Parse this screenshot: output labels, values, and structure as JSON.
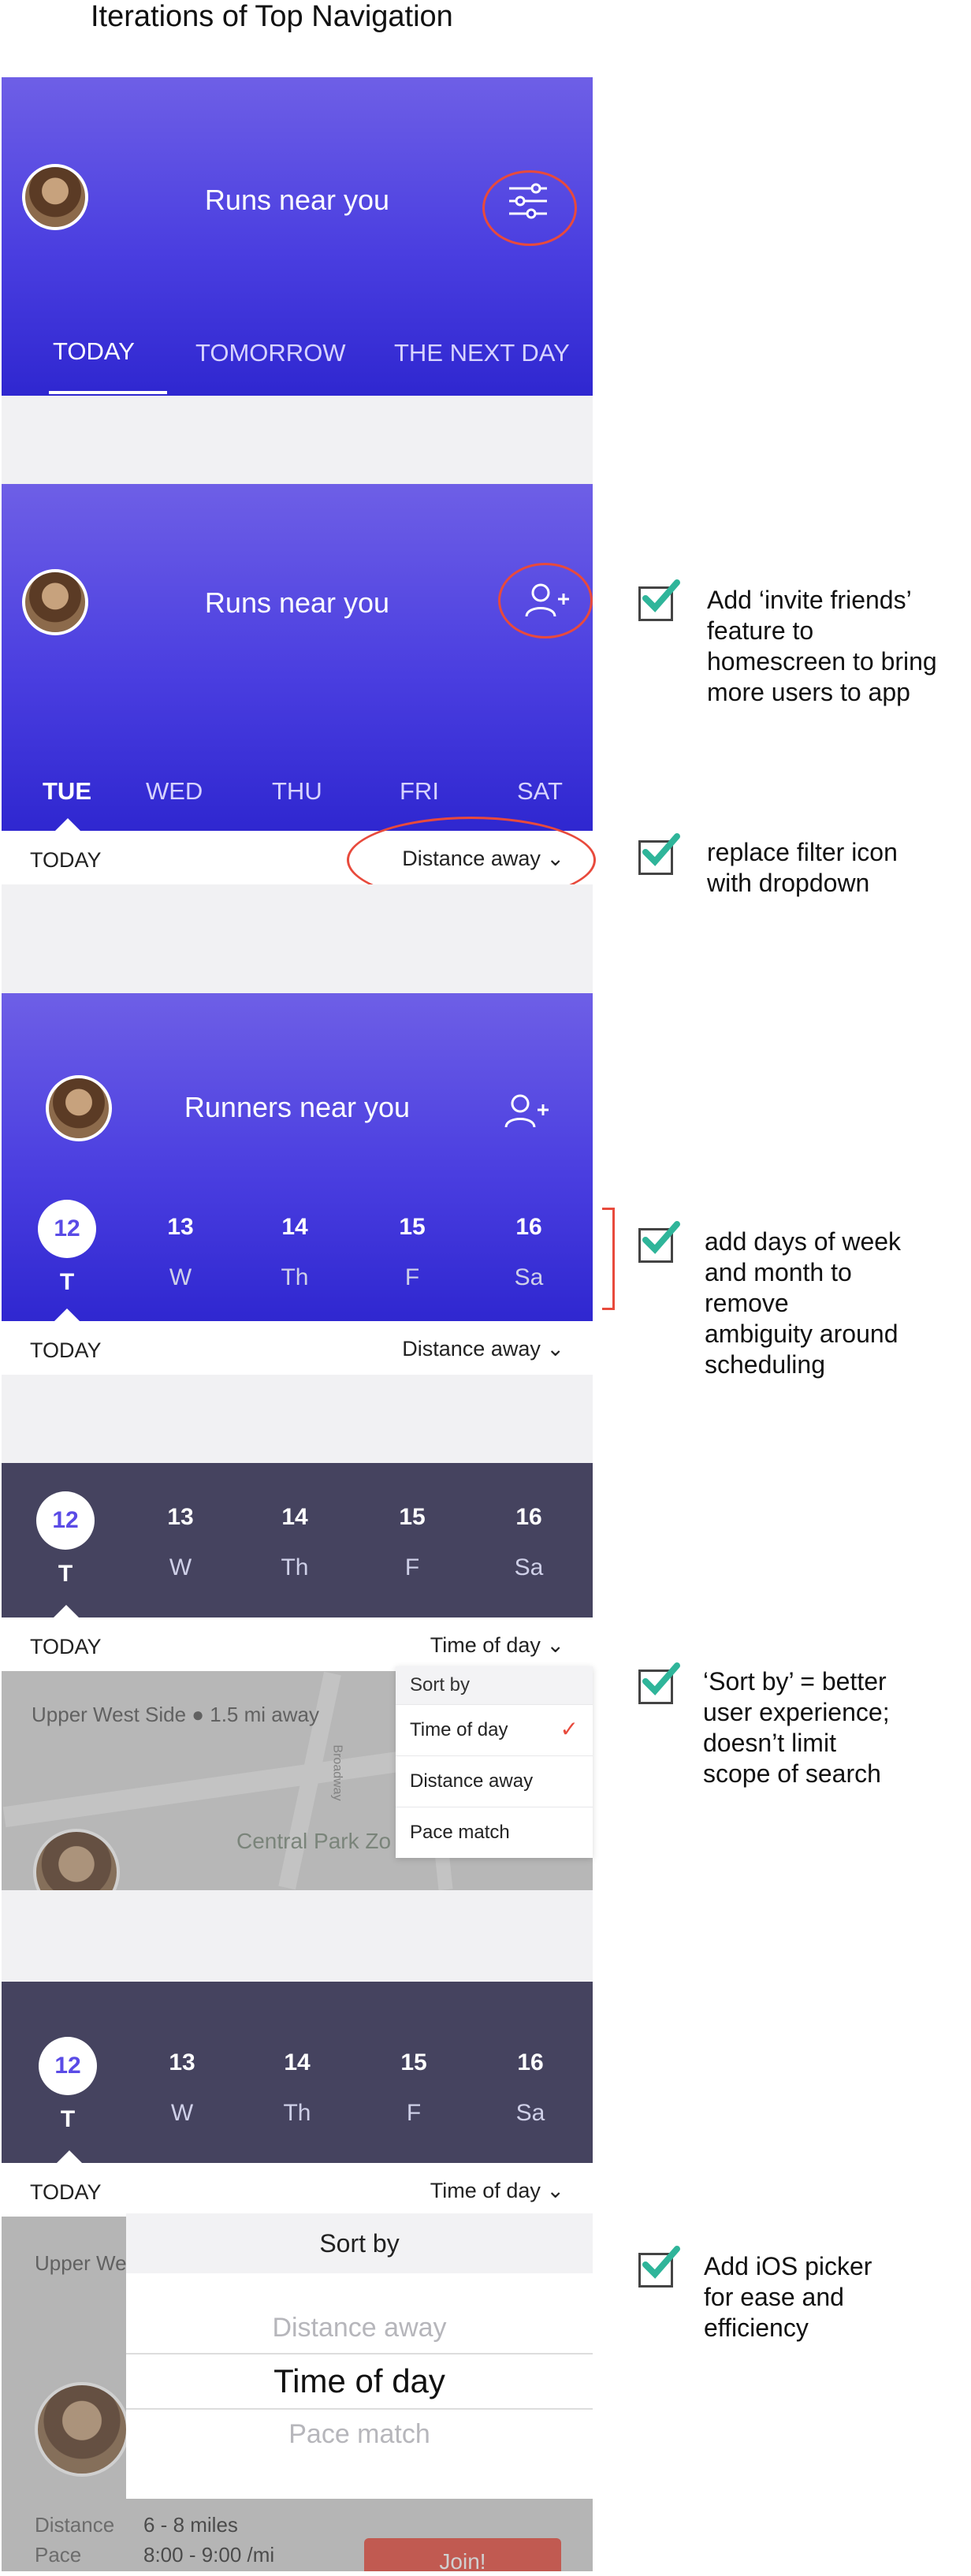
{
  "page_title": "Iterations of Top Navigation",
  "colors": {
    "brand": "#4a3ee0",
    "dark_header": "#45435f",
    "check": "#2fb59a",
    "annotation": "#e84a3c"
  },
  "screen1": {
    "title": "Runs near you",
    "tabs": [
      "TODAY",
      "TOMORROW",
      "THE NEXT DAY"
    ],
    "action_icon": "filter-sliders-icon"
  },
  "screen2": {
    "title": "Runs near you",
    "action_icon": "add-user-icon",
    "days": [
      "TUE",
      "WED",
      "THU",
      "FRI",
      "SAT"
    ],
    "subbar_left": "TODAY",
    "subbar_right": "Distance away"
  },
  "screen3": {
    "title": "Runners near you",
    "action_icon": "add-user-icon",
    "days": [
      {
        "num": "12",
        "wk": "T"
      },
      {
        "num": "13",
        "wk": "W"
      },
      {
        "num": "14",
        "wk": "Th"
      },
      {
        "num": "15",
        "wk": "F"
      },
      {
        "num": "16",
        "wk": "Sa"
      }
    ],
    "subbar_left": "TODAY",
    "subbar_right": "Distance away"
  },
  "screen4": {
    "days": [
      {
        "num": "12",
        "wk": "T"
      },
      {
        "num": "13",
        "wk": "W"
      },
      {
        "num": "14",
        "wk": "Th"
      },
      {
        "num": "15",
        "wk": "F"
      },
      {
        "num": "16",
        "wk": "Sa"
      }
    ],
    "subbar_left": "TODAY",
    "subbar_right": "Time of day",
    "location": "Upper West Side",
    "distance": "1.5 mi away",
    "map_label": "Central Park Zo",
    "street": "Broadway",
    "dropdown": {
      "header": "Sort by",
      "options": [
        "Time of day",
        "Distance away",
        "Pace match"
      ],
      "selected": "Time of day"
    }
  },
  "screen5": {
    "days": [
      {
        "num": "12",
        "wk": "T"
      },
      {
        "num": "13",
        "wk": "W"
      },
      {
        "num": "14",
        "wk": "Th"
      },
      {
        "num": "15",
        "wk": "F"
      },
      {
        "num": "16",
        "wk": "Sa"
      }
    ],
    "subbar_left": "TODAY",
    "subbar_right": "Time of day",
    "location": "Upper We",
    "picker": {
      "header": "Sort by",
      "options": [
        "Distance away",
        "Time of day",
        "Pace match"
      ],
      "selected": "Time of day"
    },
    "details": [
      {
        "label": "Distance",
        "value": "6 - 8 miles"
      },
      {
        "label": "Pace",
        "value": "8:00 - 9:00 /mi"
      }
    ],
    "join_label": "Join!"
  },
  "notes": [
    "Add ‘invite friends’\nfeature to\nhomescreen to bring\nmore users to app",
    "replace filter icon\nwith dropdown",
    "add days of week\nand month to\nremove\nambiguity around\nscheduling",
    "‘Sort by’ = better\nuser experience;\ndoesn’t limit\nscope of search",
    "Add iOS picker\nfor ease and\nefficiency"
  ]
}
